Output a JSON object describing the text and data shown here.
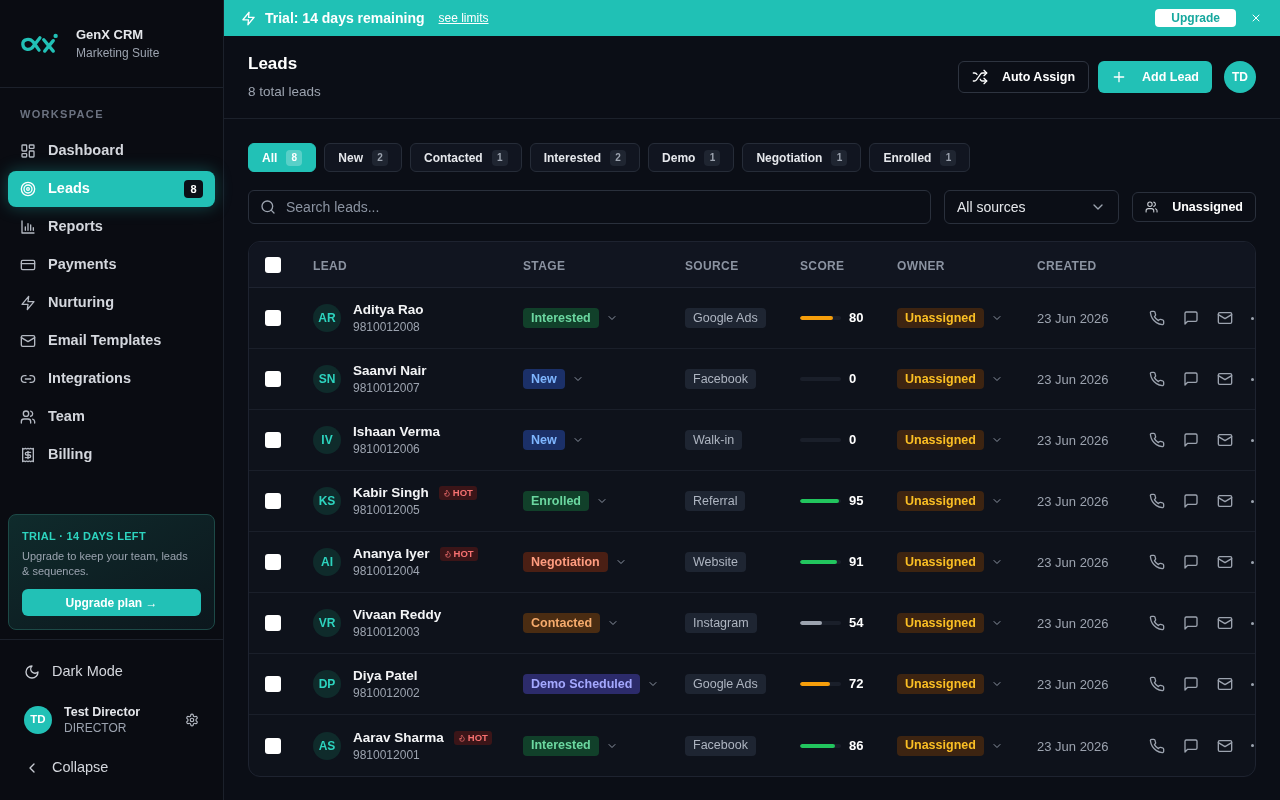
{
  "banner": {
    "message": "Trial: 14 days remaining",
    "link": "see limits",
    "button": "Upgrade"
  },
  "sidebar": {
    "brand": {
      "name": "GenX CRM",
      "subtitle": "Marketing Suite"
    },
    "section": "WORKSPACE",
    "items": [
      {
        "label": "Dashboard",
        "selected": false
      },
      {
        "label": "Leads",
        "selected": true,
        "badge": "8"
      },
      {
        "label": "Reports",
        "selected": false
      },
      {
        "label": "Payments",
        "selected": false
      },
      {
        "label": "Nurturing",
        "selected": false
      },
      {
        "label": "Email Templates",
        "selected": false
      },
      {
        "label": "Integrations",
        "selected": false
      },
      {
        "label": "Team",
        "selected": false
      },
      {
        "label": "Billing",
        "selected": false
      }
    ],
    "trial_card": {
      "title": "TRIAL · 14 DAYS LEFT",
      "text": "Upgrade to keep your team, leads & sequences.",
      "button": "Upgrade plan →"
    },
    "theme_toggle": {
      "label": "Dark Mode"
    },
    "user": {
      "initials": "TD",
      "name": "Test Director",
      "role": "DIRECTOR"
    },
    "collapse": {
      "label": "Collapse"
    }
  },
  "header": {
    "title": "Leads",
    "subtitle": "8 total leads",
    "buttons": [
      {
        "label": "Auto Assign",
        "kind": "secondary"
      },
      {
        "label": "Add Lead",
        "kind": "primary"
      }
    ],
    "avatar": "TD"
  },
  "filters": [
    {
      "label": "All",
      "count": "8",
      "selected": true
    },
    {
      "label": "New",
      "count": "2",
      "selected": false
    },
    {
      "label": "Contacted",
      "count": "1",
      "selected": false
    },
    {
      "label": "Interested",
      "count": "2",
      "selected": false
    },
    {
      "label": "Demo",
      "count": "1",
      "selected": false
    },
    {
      "label": "Negotiation",
      "count": "1",
      "selected": false
    },
    {
      "label": "Enrolled",
      "count": "1",
      "selected": false
    }
  ],
  "search": {
    "placeholder": "Search leads..."
  },
  "source_filter": {
    "value": "All sources"
  },
  "owner_filter": {
    "label": "Unassigned"
  },
  "table": {
    "all_checked": false,
    "columns": [
      "LEAD",
      "STAGE",
      "SOURCE",
      "SCORE",
      "OWNER",
      "CREATED"
    ],
    "rows": [
      {
        "checked": false,
        "initials": "AR",
        "name": "Aditya Rao",
        "phone": "9810012008",
        "stage": {
          "label": "Interested",
          "color": "#11402a"
        },
        "source": "Google Ads",
        "score": {
          "value": "80",
          "level": 0.8
        },
        "owner": "Unassigned",
        "created": "23 Jun 2026"
      },
      {
        "checked": false,
        "initials": "SN",
        "name": "Saanvi Nair",
        "phone": "9810012007",
        "stage": {
          "label": "New",
          "color": "#1b3068"
        },
        "source": "Facebook",
        "score": {
          "value": "0",
          "level": 0
        },
        "owner": "Unassigned",
        "created": "23 Jun 2026"
      },
      {
        "checked": false,
        "initials": "IV",
        "name": "Ishaan Verma",
        "phone": "9810012006",
        "stage": {
          "label": "New",
          "color": "#1b3068"
        },
        "source": "Walk-in",
        "score": {
          "value": "0",
          "level": 0
        },
        "owner": "Unassigned",
        "created": "23 Jun 2026"
      },
      {
        "checked": false,
        "initials": "KS",
        "name": "Kabir Singh",
        "tag": "HOT",
        "phone": "9810012005",
        "stage": {
          "label": "Enrolled",
          "color": "#11402a"
        },
        "source": "Referral",
        "score": {
          "value": "95",
          "level": 0.95
        },
        "owner": "Unassigned",
        "created": "23 Jun 2026"
      },
      {
        "checked": false,
        "initials": "AI",
        "name": "Ananya Iyer",
        "tag": "HOT",
        "phone": "9810012004",
        "stage": {
          "label": "Negotiation",
          "color": "#4a1f14"
        },
        "source": "Website",
        "score": {
          "value": "91",
          "level": 0.91
        },
        "owner": "Unassigned",
        "created": "23 Jun 2026"
      },
      {
        "checked": false,
        "initials": "VR",
        "name": "Vivaan Reddy",
        "phone": "9810012003",
        "stage": {
          "label": "Contacted",
          "color": "#4a2c12"
        },
        "source": "Instagram",
        "score": {
          "value": "54",
          "level": 0.54
        },
        "owner": "Unassigned",
        "created": "23 Jun 2026"
      },
      {
        "checked": false,
        "initials": "DP",
        "name": "Diya Patel",
        "phone": "9810012002",
        "stage": {
          "label": "Demo Scheduled",
          "color": "#2c2b6b"
        },
        "source": "Google Ads",
        "score": {
          "value": "72",
          "level": 0.72
        },
        "owner": "Unassigned",
        "created": "23 Jun 2026"
      },
      {
        "checked": false,
        "initials": "AS",
        "name": "Aarav Sharma",
        "tag": "HOT",
        "phone": "9810012001",
        "stage": {
          "label": "Interested",
          "color": "#11402a"
        },
        "source": "Facebook",
        "score": {
          "value": "86",
          "level": 0.86
        },
        "owner": "Unassigned",
        "created": "23 Jun 2026"
      }
    ]
  }
}
